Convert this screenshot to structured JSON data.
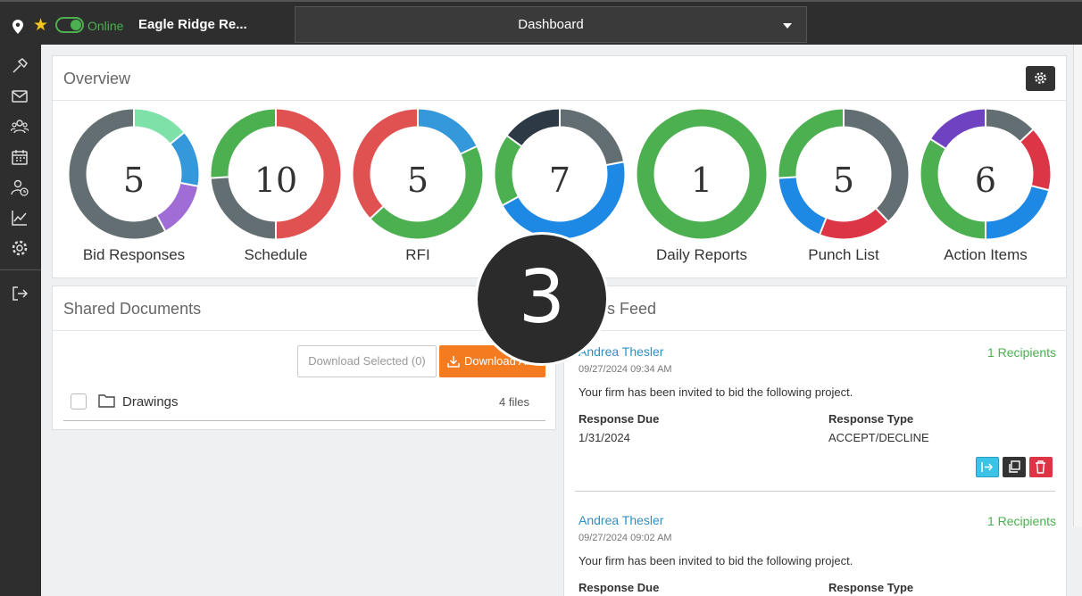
{
  "topbar": {
    "status": "Online",
    "project_name": "Eagle Ridge Re...",
    "view_select": "Dashboard"
  },
  "sidebar": {
    "items": [
      "hammer-icon",
      "mail-icon",
      "team-icon",
      "calendar-icon",
      "user-clock-icon",
      "chart-icon",
      "settings-icon",
      "logout-icon"
    ]
  },
  "overview": {
    "title": "Overview",
    "widgets": [
      {
        "label": "Bid Responses",
        "value": "5"
      },
      {
        "label": "Schedule",
        "value": "10"
      },
      {
        "label": "RFI",
        "value": "5"
      },
      {
        "label": "",
        "value": "7"
      },
      {
        "label": "Daily Reports",
        "value": "1"
      },
      {
        "label": "Punch List",
        "value": "5"
      },
      {
        "label": "Action Items",
        "value": "6"
      }
    ]
  },
  "colors": {
    "gray": "#636e72",
    "light_green": "#7ee2a8",
    "blue": "#3498db",
    "purple": "#a06cd5",
    "green": "#4caf50",
    "red": "#e05252",
    "dark": "#2d3a45",
    "deep_purple": "#6f42c1",
    "accent_orange": "#f47b20"
  },
  "shared_documents": {
    "title": "Shared Documents",
    "download_selected": "Download Selected (0)",
    "download_all": "Download All",
    "folders": [
      {
        "name": "Drawings",
        "count": "4 files"
      }
    ]
  },
  "news_feed": {
    "title": "s Feed",
    "items": [
      {
        "author": "Andrea Thesler",
        "recipients": "1 Recipients",
        "time": "09/27/2024 09:34 AM",
        "text": "Your firm has been invited to bid the following project.",
        "response_due_label": "Response Due",
        "response_due": "1/31/2024",
        "response_type_label": "Response Type",
        "response_type": "ACCEPT/DECLINE"
      },
      {
        "author": "Andrea Thesler",
        "recipients": "1 Recipients",
        "time": "09/27/2024 09:02 AM",
        "text": "Your firm has been invited to bid the following project.",
        "response_due_label": "Response Due",
        "response_type_label": "Response Type"
      }
    ]
  },
  "step_badge": "3"
}
